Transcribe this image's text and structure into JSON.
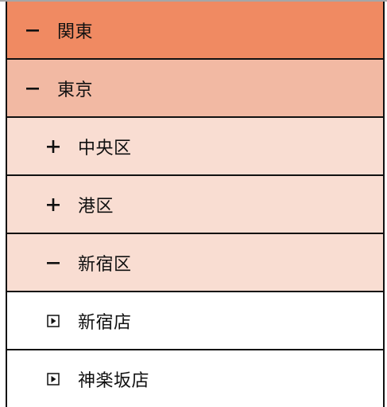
{
  "tree": {
    "nodes": [
      {
        "label": "関東",
        "level": 1,
        "toggle": "collapse",
        "icon": "minus-icon"
      },
      {
        "label": "東京",
        "level": 2,
        "toggle": "collapse",
        "icon": "minus-icon"
      },
      {
        "label": "中央区",
        "level": 3,
        "toggle": "expand",
        "icon": "plus-icon"
      },
      {
        "label": "港区",
        "level": 3,
        "toggle": "expand",
        "icon": "plus-icon"
      },
      {
        "label": "新宿区",
        "level": 3,
        "toggle": "collapse",
        "icon": "minus-icon"
      },
      {
        "label": "新宿店",
        "level": 4,
        "toggle": "leaf",
        "icon": "play-square-icon"
      },
      {
        "label": "神楽坂店",
        "level": 4,
        "toggle": "leaf",
        "icon": "play-square-icon"
      }
    ]
  },
  "colors": {
    "level1": "#f08a62",
    "level2": "#f2b9a3",
    "level3": "#f9ddd2",
    "level4": "#ffffff",
    "border": "#111111",
    "text": "#111111"
  }
}
